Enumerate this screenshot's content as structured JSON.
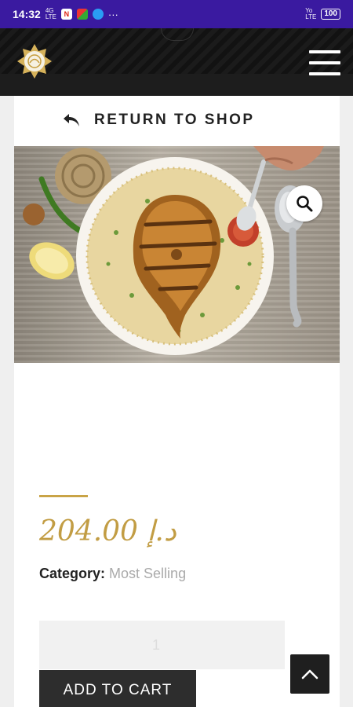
{
  "status_bar": {
    "time": "14:32",
    "net_top": "4G",
    "net_bottom": "LTE",
    "battery": "100",
    "more": "···",
    "right_net_top": "Yo",
    "right_net_bottom": "LTE"
  },
  "header": {
    "logo_icon": "ornamental-star-logo",
    "menu_icon": "hamburger-menu-icon"
  },
  "navigation": {
    "return_label": "RETURN TO SHOP",
    "return_icon": "reply-arrow-icon"
  },
  "product": {
    "image_icon": "fish-rice-dish",
    "zoom_icon": "magnifier-icon",
    "price": "204.00 د.إ",
    "category_label": "Category:",
    "category_value": "Most Selling",
    "quantity": "1",
    "add_to_cart_label": "ADD TO CART"
  },
  "scroll_top_icon": "chevron-up-icon",
  "colors": {
    "status_bar": "#3a1aa0",
    "header": "#141414",
    "gold_accent": "#c29d44",
    "cart_button": "#2d2d2d"
  }
}
